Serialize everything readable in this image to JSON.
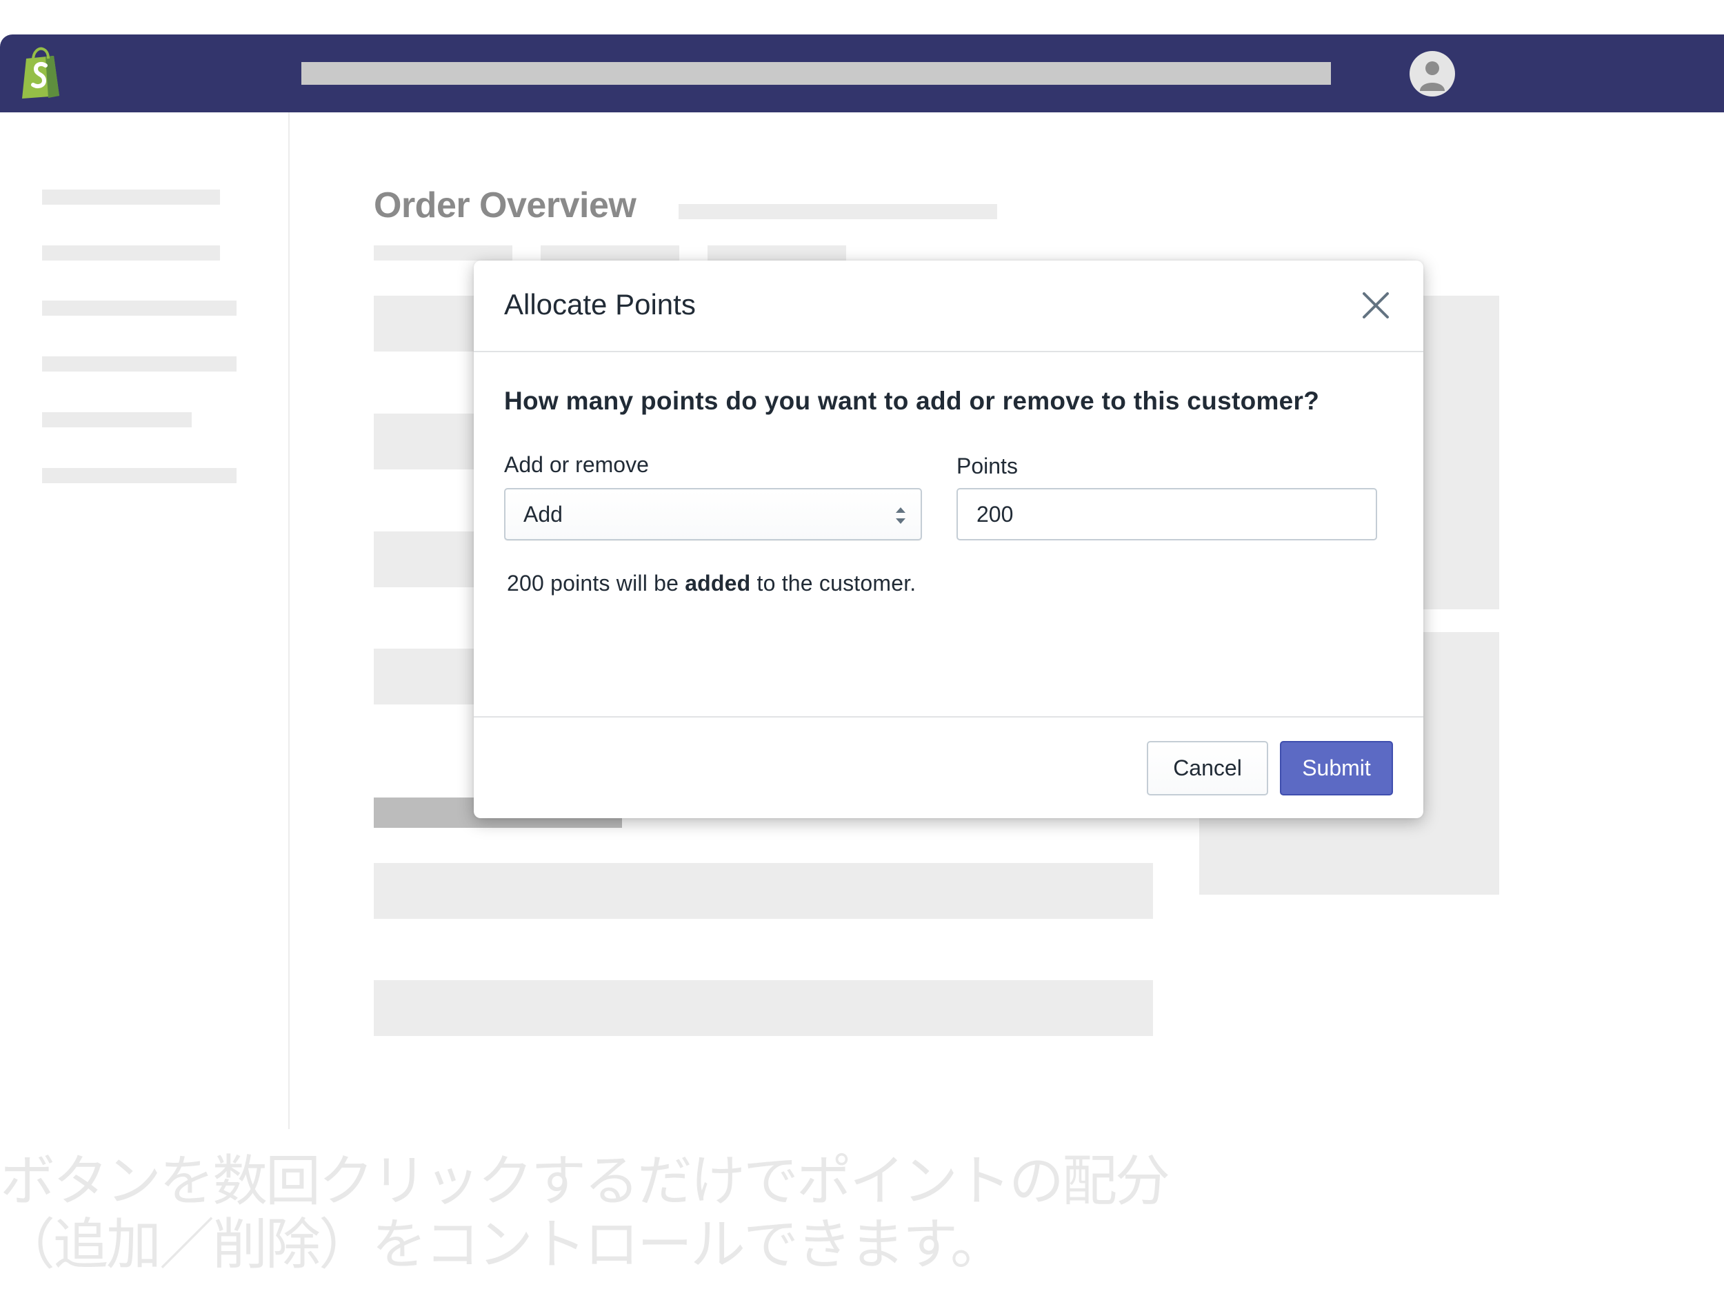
{
  "topbar": {
    "logo_icon": "shopify-bag-logo-icon",
    "avatar_icon": "user-avatar-icon",
    "bg_color": "#33356c"
  },
  "page": {
    "title": "Order Overview"
  },
  "modal": {
    "title": "Allocate Points",
    "close_icon": "close-x-icon",
    "question": "How many points do you want to add or remove to this customer?",
    "add_remove": {
      "label": "Add or remove",
      "value": "Add",
      "icon": "select-arrows-icon"
    },
    "points": {
      "label": "Points",
      "value": "200"
    },
    "summary": {
      "prefix": "200 points will be",
      "emphasis": "added",
      "suffix": "to the customer."
    },
    "cancel_label": "Cancel",
    "submit_label": "Submit",
    "submit_color": "#5c6ac4"
  },
  "caption": {
    "line1": "ボタンを数回クリックするだけでポイントの配分",
    "line2": "（追加／削除）をコントロールできます。"
  }
}
